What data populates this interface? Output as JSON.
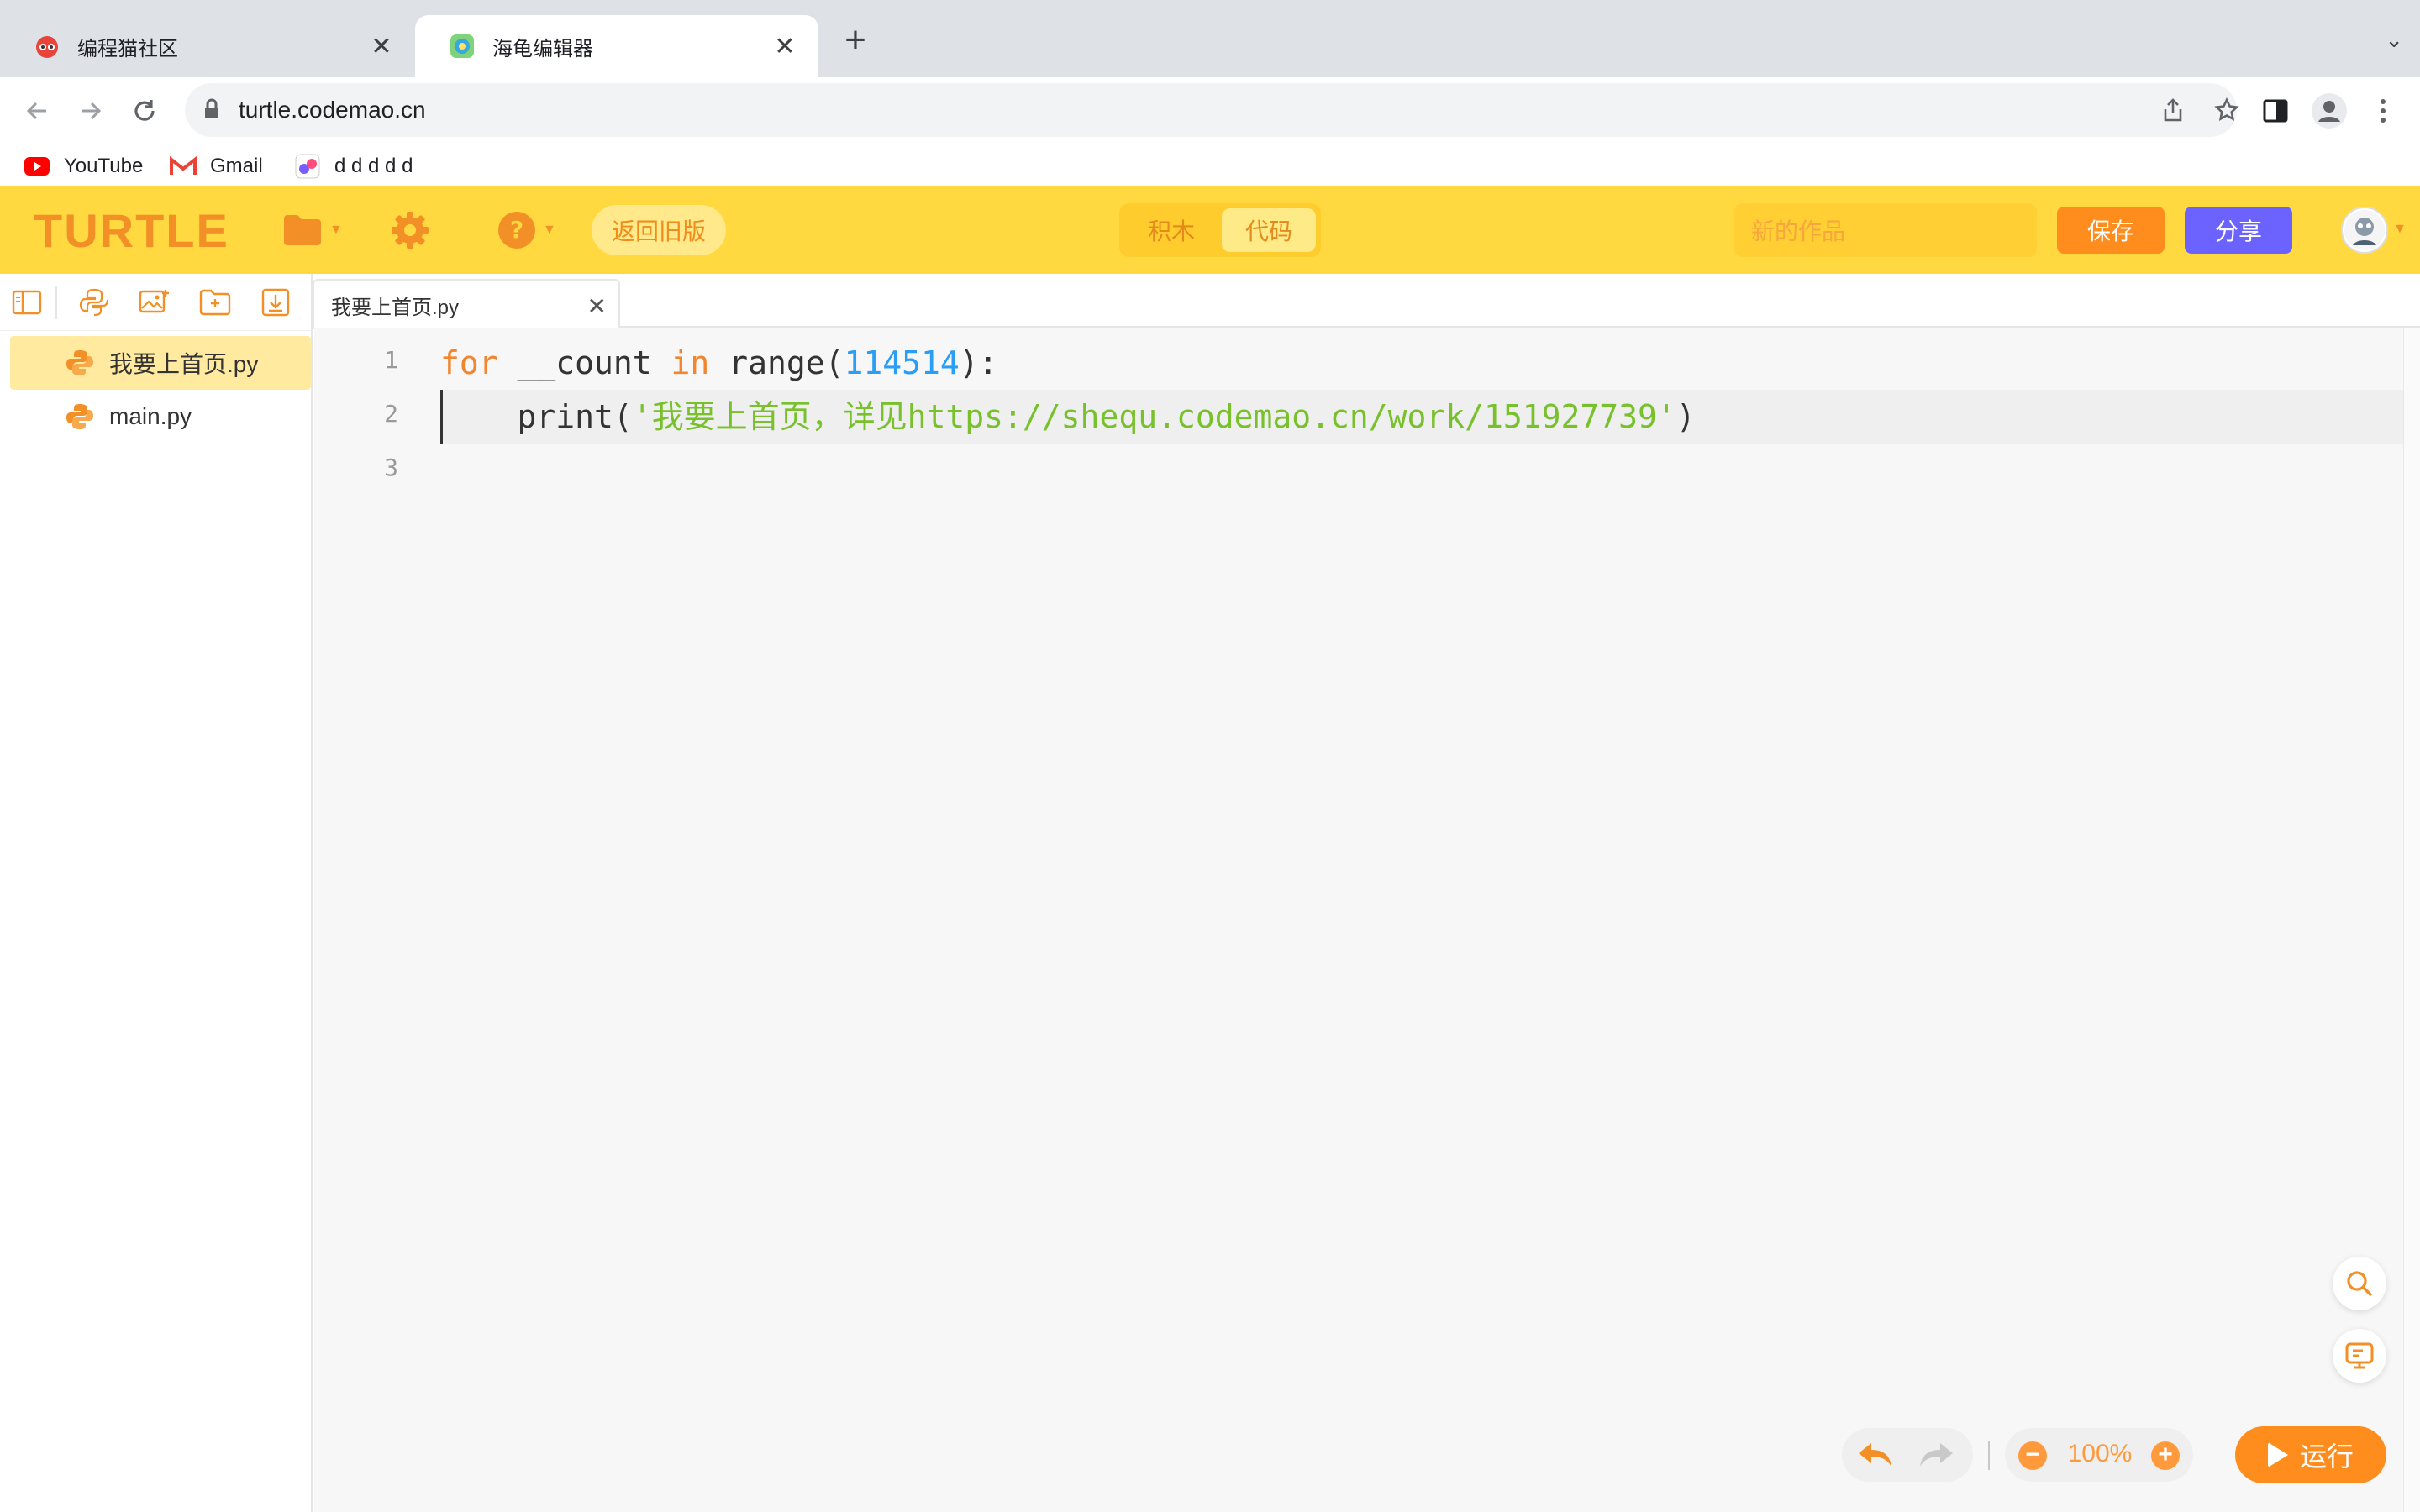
{
  "browser": {
    "tabs": [
      {
        "title": "编程猫社区",
        "active": false
      },
      {
        "title": "海龟编辑器",
        "active": true
      }
    ],
    "new_tab": "+",
    "close": "✕",
    "url": "turtle.codemao.cn",
    "bookmarks": [
      {
        "label": "YouTube",
        "icon": "youtube-icon"
      },
      {
        "label": "Gmail",
        "icon": "gmail-icon"
      },
      {
        "label": "d d d d d",
        "icon": "bookmark-favicon-icon"
      }
    ]
  },
  "app": {
    "logo": "TURTLE",
    "back_to_old": "返回旧版",
    "mode_toggle": {
      "blocks": "积木",
      "code": "代码",
      "active": "代码"
    },
    "work_name_placeholder": "新的作品",
    "save": "保存",
    "share": "分享",
    "colors": {
      "header": "#ffd93f",
      "accent": "#f28f26",
      "save": "#ff8d1e",
      "share": "#6c63ff",
      "active_file": "#ffeaa0"
    }
  },
  "sidebar": {
    "files": [
      {
        "name": "我要上首页.py",
        "active": true
      },
      {
        "name": "main.py",
        "active": false
      }
    ]
  },
  "editor": {
    "tab_title": "我要上首页.py",
    "line_numbers": [
      "1",
      "2",
      "3"
    ],
    "code": {
      "l1_kw_for": "for",
      "l1_var": " __count ",
      "l1_kw_in": "in",
      "l1_call": " range(",
      "l1_num": "114514",
      "l1_end": "):",
      "l2_indent": "    print(",
      "l2_str": "'我要上首页，详见https://shequ.codemao.cn/work/151927739'",
      "l2_end": ")"
    }
  },
  "bottom": {
    "zoom": "100%",
    "zoom_out": "−",
    "zoom_in": "+",
    "run": "运行"
  }
}
